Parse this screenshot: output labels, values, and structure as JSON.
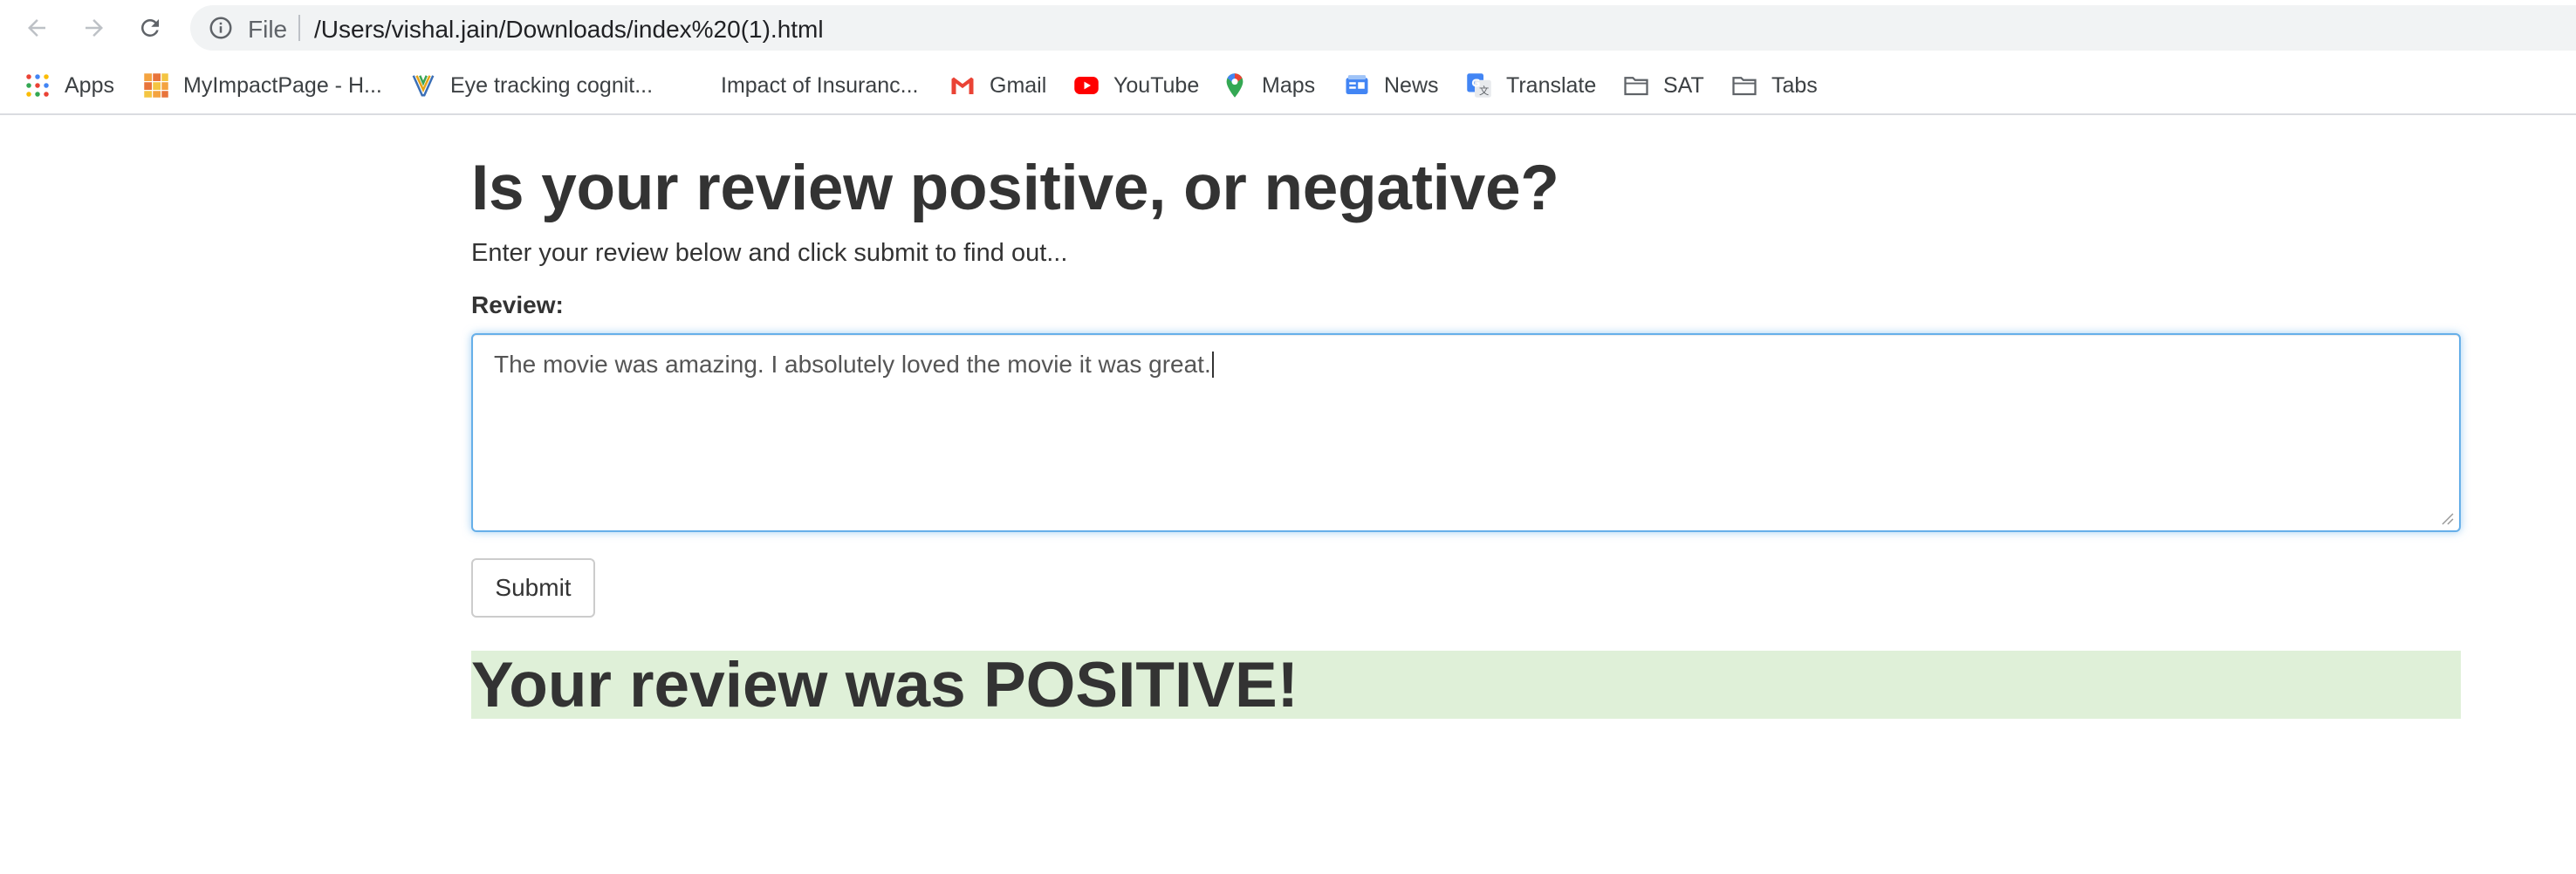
{
  "browser": {
    "omnibox": {
      "scheme_label": "File",
      "url": "/Users/vishal.jain/Downloads/index%20(1).html"
    },
    "bookmarks": [
      {
        "label": "Apps",
        "icon": "apps-grid-icon"
      },
      {
        "label": "MyImpactPage - H...",
        "icon": "myimpactpage-icon"
      },
      {
        "label": "Eye tracking cognit...",
        "icon": "eye-tracking-icon"
      },
      {
        "label": "Impact of Insuranc...",
        "icon": "blank-page-icon"
      },
      {
        "label": "Gmail",
        "icon": "gmail-icon"
      },
      {
        "label": "YouTube",
        "icon": "youtube-icon"
      },
      {
        "label": "Maps",
        "icon": "maps-pin-icon"
      },
      {
        "label": "News",
        "icon": "news-icon"
      },
      {
        "label": "Translate",
        "icon": "translate-icon"
      },
      {
        "label": "SAT",
        "icon": "folder-icon"
      },
      {
        "label": "Tabs",
        "icon": "folder-icon"
      }
    ]
  },
  "page": {
    "heading": "Is your review positive, or negative?",
    "intro": "Enter your review below and click submit to find out...",
    "review_label": "Review:",
    "review_text": "The movie was amazing. I absolutely loved the movie it was great.",
    "submit_label": "Submit",
    "result": "Your review was POSITIVE!"
  },
  "colors": {
    "result_background": "#dff0d8",
    "focus_border": "#66afe9",
    "text": "#333333"
  }
}
